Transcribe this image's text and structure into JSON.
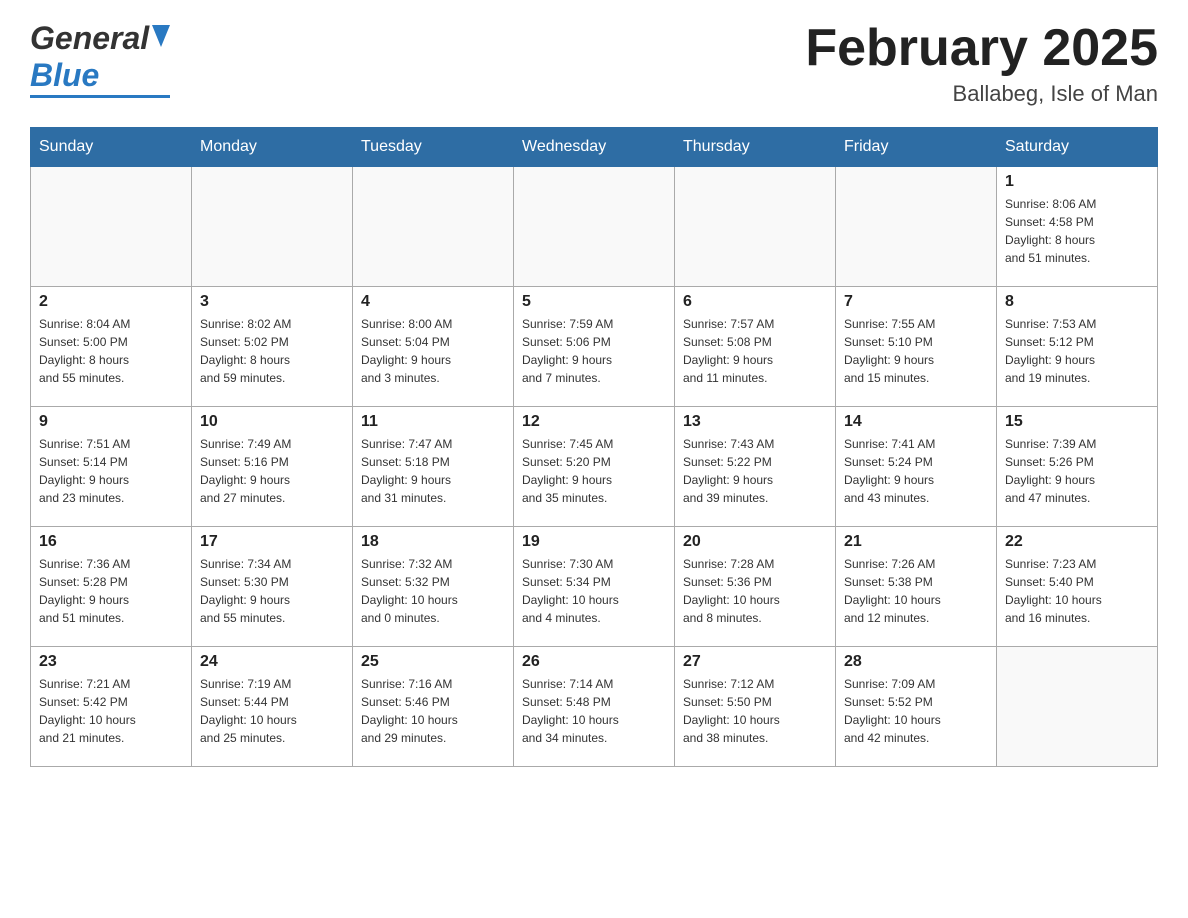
{
  "header": {
    "title": "February 2025",
    "location": "Ballabeg, Isle of Man",
    "logo_general": "General",
    "logo_blue": "Blue"
  },
  "weekdays": [
    "Sunday",
    "Monday",
    "Tuesday",
    "Wednesday",
    "Thursday",
    "Friday",
    "Saturday"
  ],
  "weeks": [
    [
      {
        "day": "",
        "info": ""
      },
      {
        "day": "",
        "info": ""
      },
      {
        "day": "",
        "info": ""
      },
      {
        "day": "",
        "info": ""
      },
      {
        "day": "",
        "info": ""
      },
      {
        "day": "",
        "info": ""
      },
      {
        "day": "1",
        "info": "Sunrise: 8:06 AM\nSunset: 4:58 PM\nDaylight: 8 hours\nand 51 minutes."
      }
    ],
    [
      {
        "day": "2",
        "info": "Sunrise: 8:04 AM\nSunset: 5:00 PM\nDaylight: 8 hours\nand 55 minutes."
      },
      {
        "day": "3",
        "info": "Sunrise: 8:02 AM\nSunset: 5:02 PM\nDaylight: 8 hours\nand 59 minutes."
      },
      {
        "day": "4",
        "info": "Sunrise: 8:00 AM\nSunset: 5:04 PM\nDaylight: 9 hours\nand 3 minutes."
      },
      {
        "day": "5",
        "info": "Sunrise: 7:59 AM\nSunset: 5:06 PM\nDaylight: 9 hours\nand 7 minutes."
      },
      {
        "day": "6",
        "info": "Sunrise: 7:57 AM\nSunset: 5:08 PM\nDaylight: 9 hours\nand 11 minutes."
      },
      {
        "day": "7",
        "info": "Sunrise: 7:55 AM\nSunset: 5:10 PM\nDaylight: 9 hours\nand 15 minutes."
      },
      {
        "day": "8",
        "info": "Sunrise: 7:53 AM\nSunset: 5:12 PM\nDaylight: 9 hours\nand 19 minutes."
      }
    ],
    [
      {
        "day": "9",
        "info": "Sunrise: 7:51 AM\nSunset: 5:14 PM\nDaylight: 9 hours\nand 23 minutes."
      },
      {
        "day": "10",
        "info": "Sunrise: 7:49 AM\nSunset: 5:16 PM\nDaylight: 9 hours\nand 27 minutes."
      },
      {
        "day": "11",
        "info": "Sunrise: 7:47 AM\nSunset: 5:18 PM\nDaylight: 9 hours\nand 31 minutes."
      },
      {
        "day": "12",
        "info": "Sunrise: 7:45 AM\nSunset: 5:20 PM\nDaylight: 9 hours\nand 35 minutes."
      },
      {
        "day": "13",
        "info": "Sunrise: 7:43 AM\nSunset: 5:22 PM\nDaylight: 9 hours\nand 39 minutes."
      },
      {
        "day": "14",
        "info": "Sunrise: 7:41 AM\nSunset: 5:24 PM\nDaylight: 9 hours\nand 43 minutes."
      },
      {
        "day": "15",
        "info": "Sunrise: 7:39 AM\nSunset: 5:26 PM\nDaylight: 9 hours\nand 47 minutes."
      }
    ],
    [
      {
        "day": "16",
        "info": "Sunrise: 7:36 AM\nSunset: 5:28 PM\nDaylight: 9 hours\nand 51 minutes."
      },
      {
        "day": "17",
        "info": "Sunrise: 7:34 AM\nSunset: 5:30 PM\nDaylight: 9 hours\nand 55 minutes."
      },
      {
        "day": "18",
        "info": "Sunrise: 7:32 AM\nSunset: 5:32 PM\nDaylight: 10 hours\nand 0 minutes."
      },
      {
        "day": "19",
        "info": "Sunrise: 7:30 AM\nSunset: 5:34 PM\nDaylight: 10 hours\nand 4 minutes."
      },
      {
        "day": "20",
        "info": "Sunrise: 7:28 AM\nSunset: 5:36 PM\nDaylight: 10 hours\nand 8 minutes."
      },
      {
        "day": "21",
        "info": "Sunrise: 7:26 AM\nSunset: 5:38 PM\nDaylight: 10 hours\nand 12 minutes."
      },
      {
        "day": "22",
        "info": "Sunrise: 7:23 AM\nSunset: 5:40 PM\nDaylight: 10 hours\nand 16 minutes."
      }
    ],
    [
      {
        "day": "23",
        "info": "Sunrise: 7:21 AM\nSunset: 5:42 PM\nDaylight: 10 hours\nand 21 minutes."
      },
      {
        "day": "24",
        "info": "Sunrise: 7:19 AM\nSunset: 5:44 PM\nDaylight: 10 hours\nand 25 minutes."
      },
      {
        "day": "25",
        "info": "Sunrise: 7:16 AM\nSunset: 5:46 PM\nDaylight: 10 hours\nand 29 minutes."
      },
      {
        "day": "26",
        "info": "Sunrise: 7:14 AM\nSunset: 5:48 PM\nDaylight: 10 hours\nand 34 minutes."
      },
      {
        "day": "27",
        "info": "Sunrise: 7:12 AM\nSunset: 5:50 PM\nDaylight: 10 hours\nand 38 minutes."
      },
      {
        "day": "28",
        "info": "Sunrise: 7:09 AM\nSunset: 5:52 PM\nDaylight: 10 hours\nand 42 minutes."
      },
      {
        "day": "",
        "info": ""
      }
    ]
  ]
}
